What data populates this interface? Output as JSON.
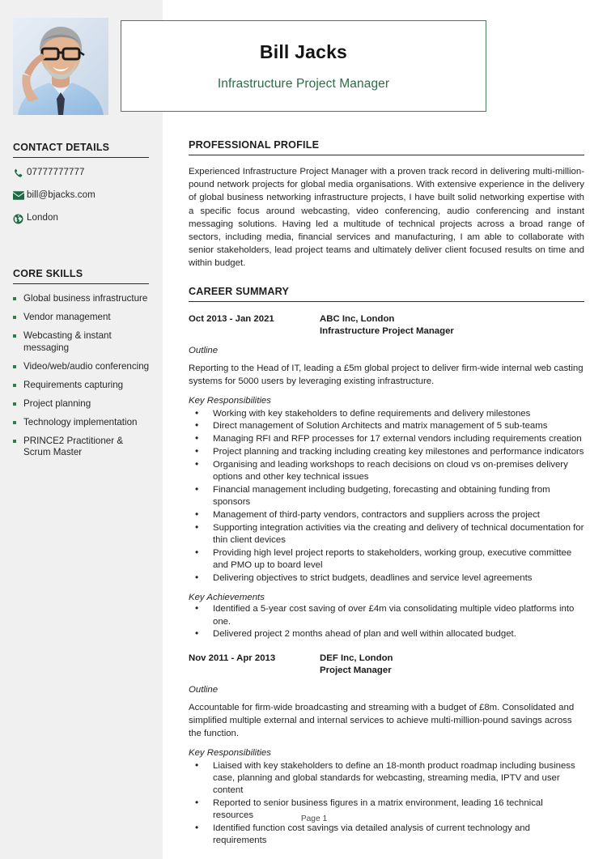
{
  "theme": {
    "accent_green": "#2c6b46",
    "border_green": "#4a7a5e",
    "sidebar_bg": "#f0f0f0",
    "heading_rule": "#2a2a2a"
  },
  "header": {
    "name": "Bill Jacks",
    "job_title": "Infrastructure Project Manager",
    "photo_alt": "profile-photo"
  },
  "sidebar": {
    "contact": {
      "heading": "CONTACT DETAILS",
      "items": [
        {
          "icon": "phone-icon",
          "value": "07777777777"
        },
        {
          "icon": "envelope-icon",
          "value": "bill@bjacks.com"
        },
        {
          "icon": "globe-icon",
          "value": "London"
        }
      ]
    },
    "skills": {
      "heading": "CORE SKILLS",
      "items": [
        "Global business infrastructure",
        "Vendor management",
        "Webcasting & instant messaging",
        "Video/web/audio conferencing",
        "Requirements capturing",
        "Project planning",
        "Technology implementation",
        "PRINCE2 Practitioner & Scrum Master"
      ]
    }
  },
  "main": {
    "profile": {
      "heading": "PROFESSIONAL PROFILE",
      "text": "Experienced Infrastructure Project Manager with a proven track record in delivering multi-million-pound network projects for global media organisations. With extensive experience in the delivery of global business networking infrastructure projects, I have built solid networking expertise with a specific focus around webcasting, video conferencing, audio conferencing and instant messaging solutions. Having led a multitude of technical projects across a broad range of sectors, including media, financial services and manufacturing, I am able to collaborate with senior stakeholders, lead project teams and ultimately deliver client focused results on time and within budget."
    },
    "career": {
      "heading": "CAREER SUMMARY",
      "jobs": [
        {
          "dates": "Oct 2013 - Jan 2021",
          "company": "ABC Inc, London",
          "role": "Infrastructure Project Manager",
          "outline_label": "Outline",
          "outline": "Reporting to the Head of IT, leading a £5m global project to deliver firm-wide internal web casting systems for 5000 users by leveraging existing infrastructure.",
          "responsibilities_label": "Key Responsibilities",
          "responsibilities": [
            "Working with key stakeholders to define requirements and delivery milestones",
            "Direct management of Solution Architects and matrix management of 5 sub-teams",
            "Managing RFI and RFP processes for 17 external vendors including requirements creation",
            "Project planning and tracking including creating key milestones and performance indicators",
            "Organising and leading workshops to reach decisions on cloud vs on-premises delivery options and other key technical issues",
            "Financial management including budgeting, forecasting and obtaining funding from sponsors",
            "Management of third-party vendors, contractors and suppliers across the project",
            "Supporting integration activities via the creating and delivery of technical documentation for thin client devices",
            "Providing high level project reports to stakeholders, working group, executive committee and PMO up to board level",
            "Delivering objectives to strict budgets, deadlines and service level agreements"
          ],
          "achievements_label": "Key Achievements",
          "achievements": [
            "Identified a 5-year cost saving of over £4m via consolidating multiple video platforms into one.",
            "Delivered project 2 months ahead of plan and well within allocated budget."
          ]
        },
        {
          "dates": "Nov 2011 - Apr 2013",
          "company": "DEF Inc, London",
          "role": "Project Manager",
          "outline_label": "Outline",
          "outline": "Accountable for firm-wide broadcasting and streaming with a budget of £8m. Consolidated and simplified multiple external and internal services to achieve multi-million-pound savings across the function.",
          "responsibilities_label": "Key Responsibilities",
          "responsibilities": [
            "Liaised with key stakeholders to define an 18-month product roadmap including business case, planning and global standards for webcasting, streaming media, IPTV and user content",
            "Reported to senior business figures in a matrix environment, leading 16 technical resources",
            "Identified function cost savings via detailed analysis of current technology and requirements"
          ],
          "achievements_label": "",
          "achievements": []
        }
      ]
    }
  },
  "footer": {
    "page_label": "Page 1"
  }
}
